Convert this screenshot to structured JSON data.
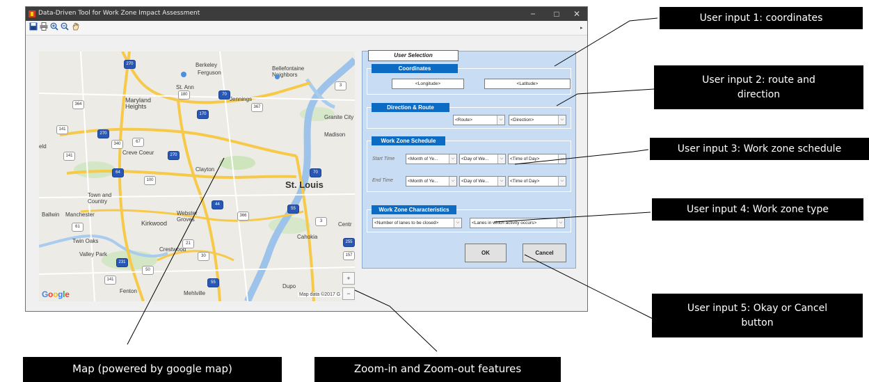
{
  "window": {
    "title": "Data-Driven Tool for Work Zone Impact Assessment",
    "controls": {
      "minimize": "−",
      "maximize": "□",
      "close": "✕"
    },
    "toolbar_icons": [
      "save-icon",
      "print-icon",
      "zoom-in-icon",
      "zoom-out-icon",
      "pan-icon"
    ]
  },
  "map": {
    "provider_logo": "Google",
    "attribution": "Map data ©2017 G",
    "labels": [
      "Berkeley",
      "Ferguson",
      "Bellefontaine Neighbors",
      "St. Ann",
      "Jennings",
      "Maryland Heights",
      "Granite City",
      "Madison",
      "Creve Coeur",
      "Clayton",
      "St. Louis",
      "Town and Country",
      "Ballwin",
      "Manchester",
      "Kirkwood",
      "Webster Groves",
      "Twin Oaks",
      "Valley Park",
      "Crestwood",
      "Cahokia",
      "Centr",
      "Fenton",
      "Mehlville",
      "Dupo",
      "eld"
    ],
    "shields": [
      "270",
      "180",
      "70",
      "367",
      "364",
      "170",
      "141",
      "270",
      "340",
      "67",
      "64",
      "70",
      "3",
      "141",
      "270",
      "100",
      "366",
      "44",
      "55",
      "255",
      "157",
      "30",
      "21",
      "50",
      "141",
      "55",
      "231",
      "61",
      "3"
    ],
    "zoom_in": "+",
    "zoom_out": "−"
  },
  "panel": {
    "title": "User Selection",
    "coordinates": {
      "title": "Coordinates",
      "longitude": "<Longitude>",
      "latitude": "<Latitude>"
    },
    "direction_route": {
      "title": "Direction & Route",
      "route": "<Route>",
      "direction": "<Direction>"
    },
    "schedule": {
      "title": "Work Zone Schedule",
      "start_label": "Start Time",
      "end_label": "End Time",
      "start_month": "<Month of Ye...",
      "start_day": "<Day of We...",
      "start_time": "<Time of Day>",
      "end_month": "<Month of Ye...",
      "end_day": "<Day of We...",
      "end_time": "<Time of Day>"
    },
    "characteristics": {
      "title": "Work Zone Characteristics",
      "lanes_closed": "<Number of lanes to be closed>",
      "lanes_activity": "<Lanes in which activity occurs>"
    },
    "ok": "OK",
    "cancel": "Cancel"
  },
  "callouts": {
    "input1": "User input 1: coordinates",
    "input2": "User input 2: route and direction",
    "input3": "User input 3: Work zone schedule",
    "input4": "User input 4: Work zone type",
    "input5": "User input 5: Okay or Cancel button",
    "map": "Map (powered by google map)",
    "zoom": "Zoom-in and Zoom-out features"
  },
  "colors": {
    "title_bar": "#3c3c3c",
    "panel_bg": "#c8dcf4",
    "section_title": "#0c6cc4",
    "callout_bg": "#000000",
    "callout_text": "#ffffff"
  }
}
